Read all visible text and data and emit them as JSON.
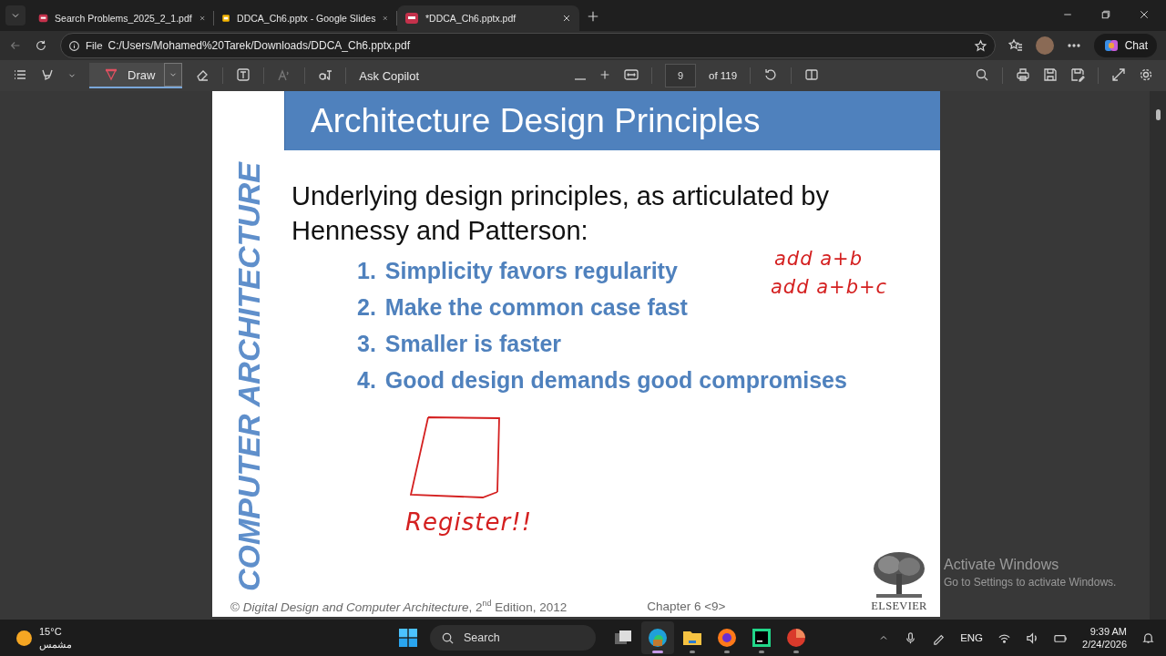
{
  "browser_tabs": [
    {
      "title": "Search Problems_2025_2_1.pdf",
      "kind": "pdf",
      "selected": false
    },
    {
      "title": "DDCA_Ch6.pptx - Google Slides",
      "kind": "slides",
      "selected": false
    },
    {
      "title": "*DDCA_Ch6.pptx.pdf",
      "kind": "pdf",
      "selected": true
    }
  ],
  "address_bar": {
    "scheme_label": "File",
    "url": "C:/Users/Mohamed%20Tarek/Downloads/DDCA_Ch6.pptx.pdf"
  },
  "chat_button": "Chat",
  "pdf_toolbar": {
    "draw_label": "Draw",
    "draw_on": true,
    "ask_label": "Ask Copilot",
    "page": "9",
    "page_count": "of 119"
  },
  "slide": {
    "side_banner": "COMPUTER ARCHITECTURE",
    "title": "Architecture Design Principles",
    "intro": "Underlying design principles, as articulated by Hennessy and Patterson:",
    "principles": [
      {
        "number": "1.",
        "text": "Simplicity favors regularity"
      },
      {
        "number": "2.",
        "text": "Make the common case fast"
      },
      {
        "number": "3.",
        "text": "Smaller is faster"
      },
      {
        "number": "4.",
        "text": "Good design demands good compromises"
      }
    ],
    "footer_source": "© *Digital Design and Computer Architecture*, 2$^{nd}$ Edition, 2012",
    "footer_chapter": "Chapter 6 <9>",
    "publisher": "ELSEVIER"
  },
  "ink_notes": [
    "add a+b",
    "add a+b+c",
    "Register!!"
  ],
  "activation_notice": {
    "title": "Activate Windows",
    "hint": "Go to Settings to activate Windows."
  },
  "taskbar": {
    "weather": {
      "temperature": "15°C",
      "condition": "مشمس"
    },
    "search_placeholder": "Search",
    "apps": [
      {
        "kind": "taskview",
        "active": false
      },
      {
        "kind": "edge",
        "active": true
      },
      {
        "kind": "files",
        "active": false
      },
      {
        "kind": "firefox",
        "active": false
      },
      {
        "kind": "ide",
        "active": false
      },
      {
        "kind": "pdfreader",
        "active": false
      }
    ],
    "language": "ENG",
    "time": "9:39 AM",
    "date": "2/24/2026"
  }
}
